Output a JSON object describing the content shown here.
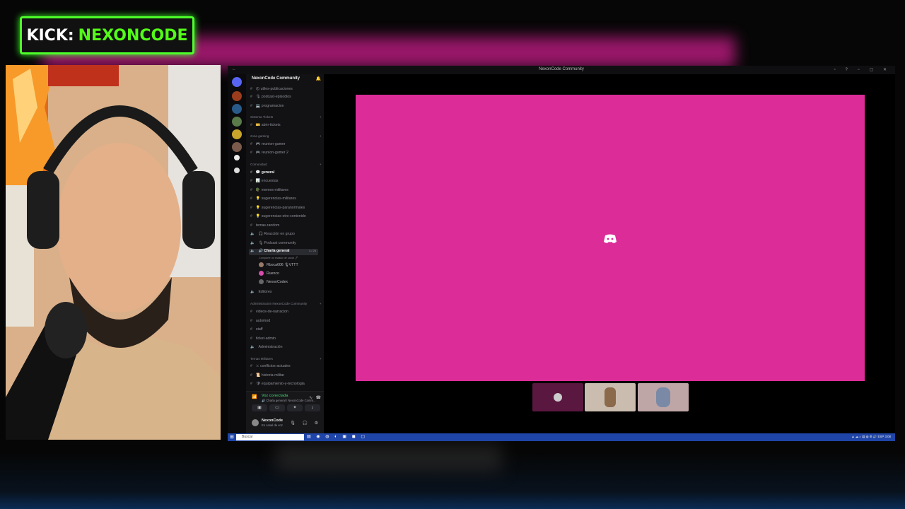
{
  "overlay": {
    "brand_prefix": "KICK:",
    "brand_name": "NEXONCODE"
  },
  "window": {
    "title": "NexonCode Community"
  },
  "server": {
    "name": "NexonCode Community"
  },
  "channels_top": [
    {
      "label": "🛈 utiles-publicaciones"
    },
    {
      "label": "🎙 podcast-episodios"
    },
    {
      "label": "💻 programacion"
    }
  ],
  "categories": {
    "tickets": "Sistema Tickets",
    "gaming": "zona gaming",
    "comunidad": "Comunidad",
    "admin": "Administración NexonCode Community",
    "militares": "Temas Militares"
  },
  "tickets_channels": [
    {
      "label": "🎫 abrir-tickets"
    }
  ],
  "gaming_channels": [
    {
      "label": "🎮 reunion-gamer"
    },
    {
      "label": "🎮 reunion-gamer 2"
    }
  ],
  "comunidad_channels": [
    {
      "label": "💬 general"
    },
    {
      "label": "📊 encuestas"
    },
    {
      "label": "🪖 memes-militares"
    },
    {
      "label": "💡 sugerencias-militares"
    },
    {
      "label": "💡 sugerencias-paranormales"
    },
    {
      "label": "💡 sugerencias-otro-contenido"
    },
    {
      "label": "temas-random"
    },
    {
      "label": "🎧 Reacción en grupo"
    },
    {
      "label": "🎙 Podcast community"
    }
  ],
  "voice": {
    "channel": "🔊 Charla general",
    "count": "4 / 25",
    "subtitle": "Comparte un estado de canal 🖊",
    "users": [
      "Rboca606 🎙VTTT",
      "Ruenco",
      "NexonCodex"
    ]
  },
  "after_voice": [
    {
      "label": "Editores"
    }
  ],
  "admin_channels": [
    {
      "label": "videos-de-narracion"
    },
    {
      "label": "automod"
    },
    {
      "label": "staff"
    },
    {
      "label": "ticket-admin"
    },
    {
      "label": "Administración"
    }
  ],
  "militares_channels": [
    {
      "label": "⚔ conflictos-actuales"
    },
    {
      "label": "📜 historia-militar"
    },
    {
      "label": "🛡 equipamiento-y-tecnologia"
    }
  ],
  "voicebox": {
    "title": "Voz conectada",
    "sub": "🔊 Charla general / NexonCode Comm...",
    "user_name": "NexonCode",
    "user_status": "En canal de voz"
  },
  "taskbar": {
    "search_placeholder": "Buscar",
    "lang": "ESP",
    "time": "3:08"
  },
  "colors": {
    "stage": "#dc2c98",
    "kick_green": "#53fc18",
    "taskbar": "#1f45a8",
    "voice_green": "#3ba55d"
  }
}
